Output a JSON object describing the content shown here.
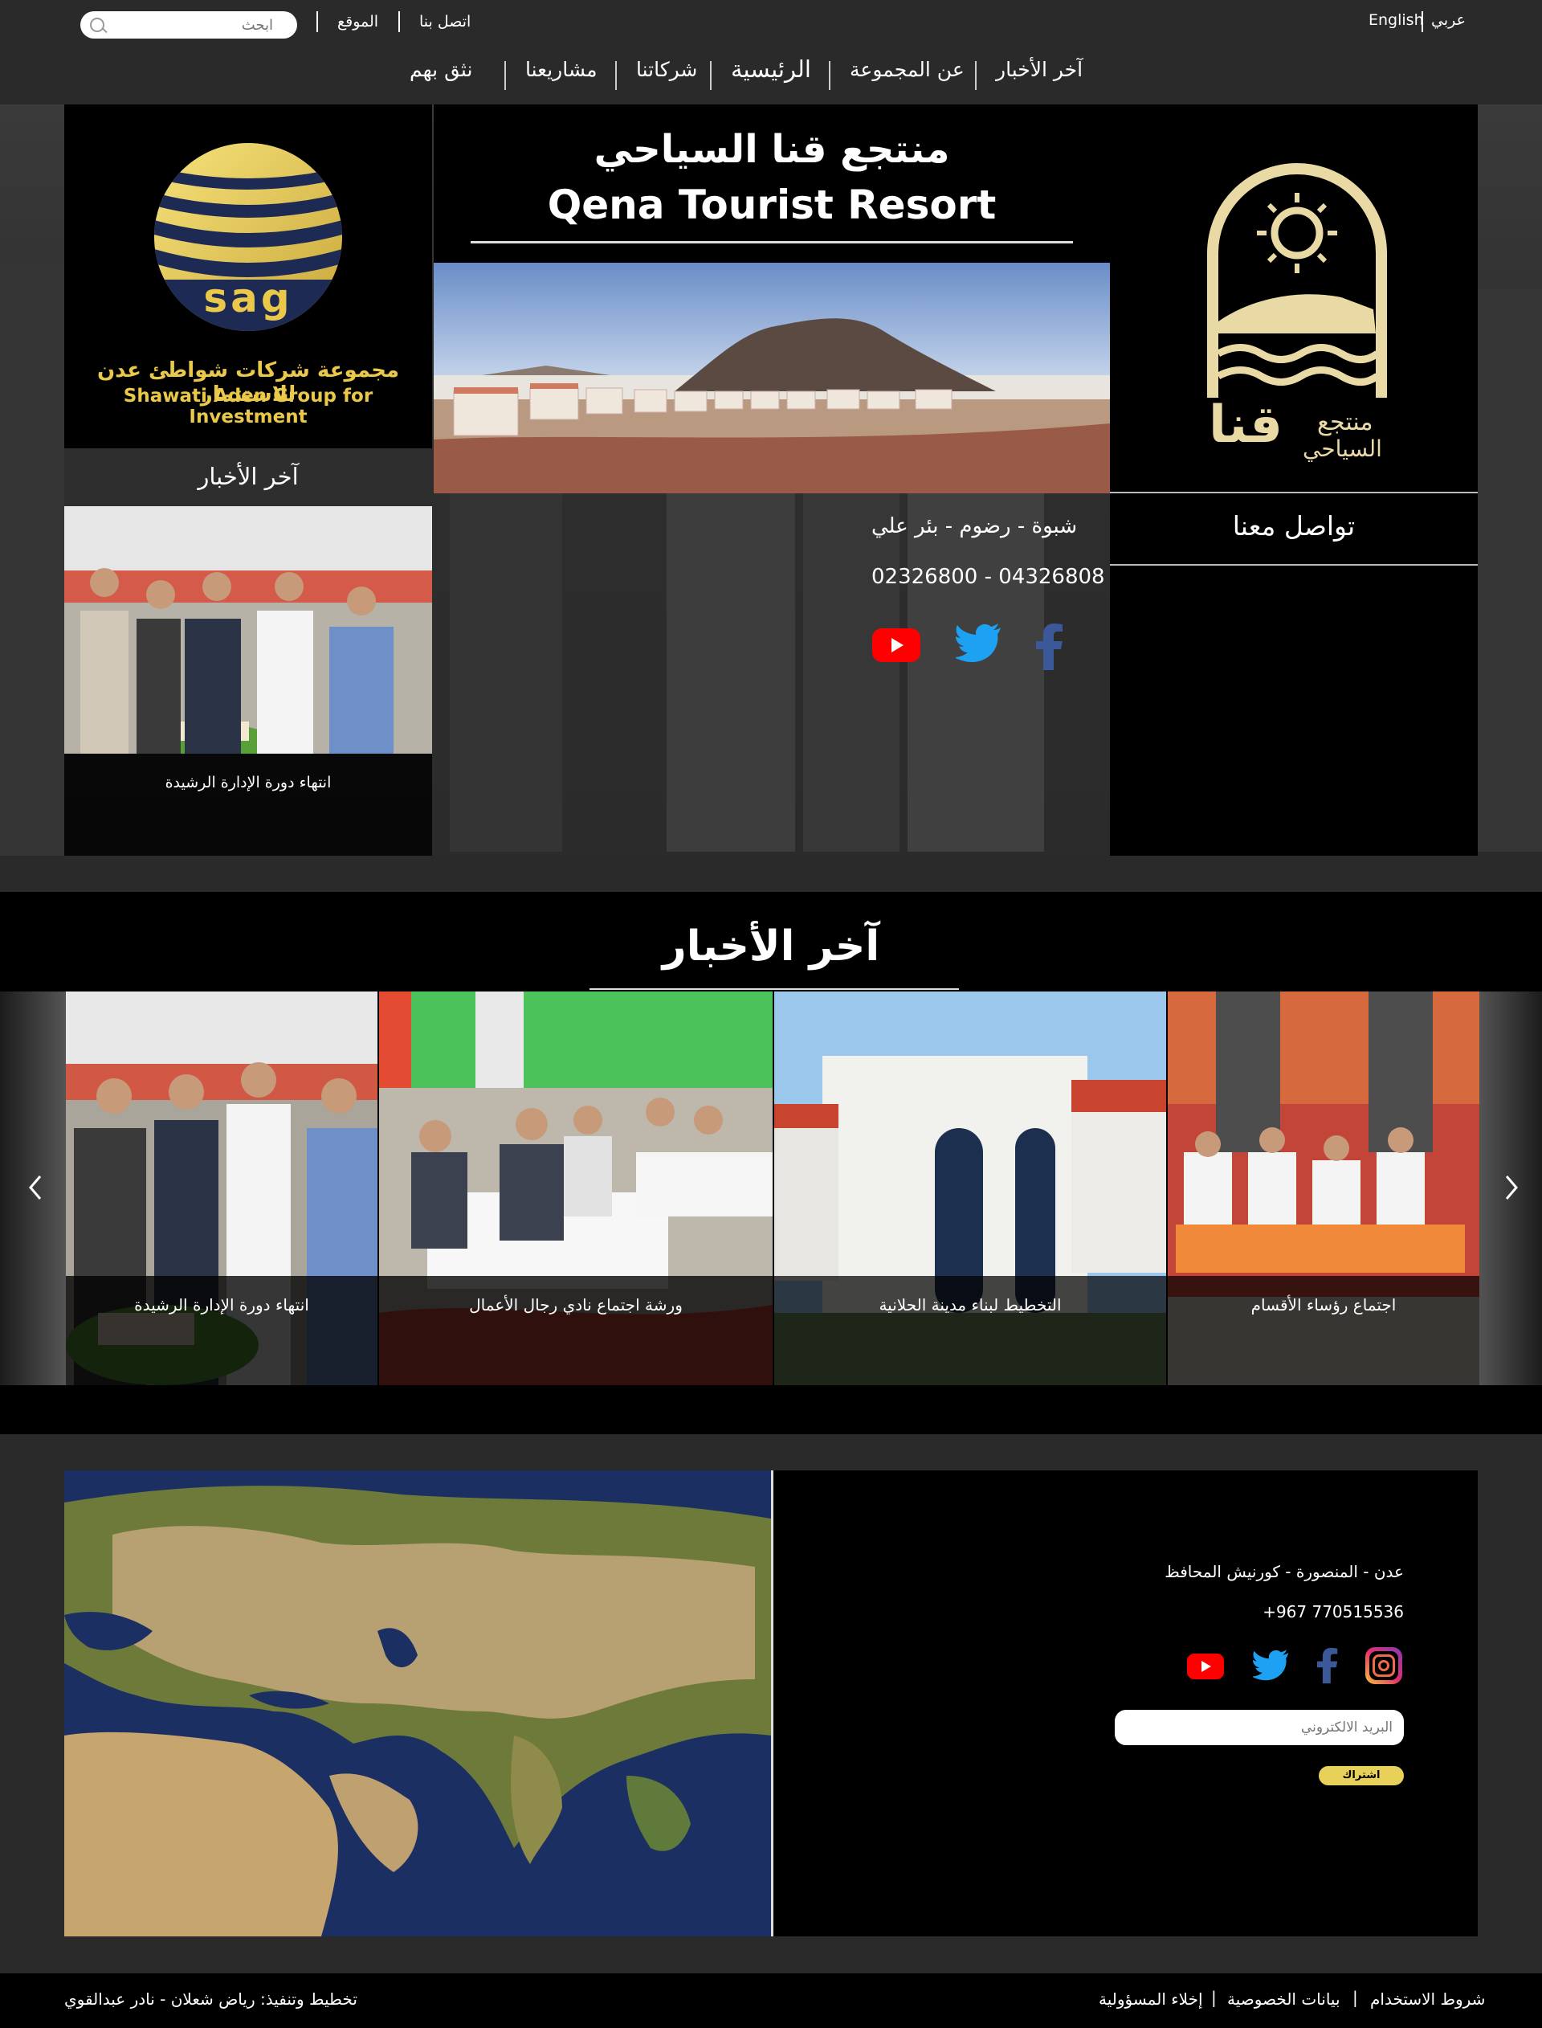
{
  "topbar": {
    "lang_ar": "عربي",
    "lang_en": "English",
    "contact": "اتصل بنا",
    "location": "الموقع",
    "search_placeholder": "ابحث"
  },
  "nav": {
    "items": [
      {
        "label": "آخر الأخبار"
      },
      {
        "label": "عن المجموعة"
      },
      {
        "label": "الرئيسية"
      },
      {
        "label": "شركاتنا"
      },
      {
        "label": "مشاريعنا"
      },
      {
        "label": "نثق بهم"
      }
    ]
  },
  "resort": {
    "logo_ar_1": "منتجع",
    "logo_ar_2": "قنا",
    "logo_ar_3": "السياحي",
    "title_ar": "منتجع قنا السياحي",
    "title_en": "Qena Tourist Resort",
    "contact_heading": "تواصل معنا",
    "address": "شبوة - رضوم - بئر علي",
    "phones": "02326800 - 04326808"
  },
  "group": {
    "logo_text": "sag",
    "name_ar": "مجموعة شركات شواطئ عدن للاستثمار",
    "name_en": "Shawati Aden Group for Investment",
    "news_heading": "آخر الأخبار",
    "news_caption": "انتهاء دورة الإدارة الرشيدة"
  },
  "news_section": {
    "heading": "آخر الأخبار",
    "cards": [
      {
        "caption": "انتهاء دورة الإدارة الرشيدة"
      },
      {
        "caption": "ورشة اجتماع نادي رجال الأعمال"
      },
      {
        "caption": "التخطيط لبناء مدينة الحلانية"
      },
      {
        "caption": "اجتماع رؤساء الأقسام"
      }
    ]
  },
  "contact_footer": {
    "address": "عدن - المنصورة - كورنيش المحافظ",
    "phone": "+967 770515536",
    "email_placeholder": "البريد الالكتروني",
    "subscribe": "اشتراك"
  },
  "footer": {
    "terms": "شروط الاستخدام",
    "privacy": "بيانات الخصوصية",
    "disclaimer": "إخلاء المسؤولية",
    "credits": "تخطيط وتنفيذ: رياض شعلان - نادر عبدالقوي"
  },
  "colors": {
    "gold": "#e9d9a4",
    "youtube": "#ff0000",
    "twitter": "#1da1f2",
    "facebook": "#3b5998",
    "subscribe_btn": "#e8d15a"
  }
}
